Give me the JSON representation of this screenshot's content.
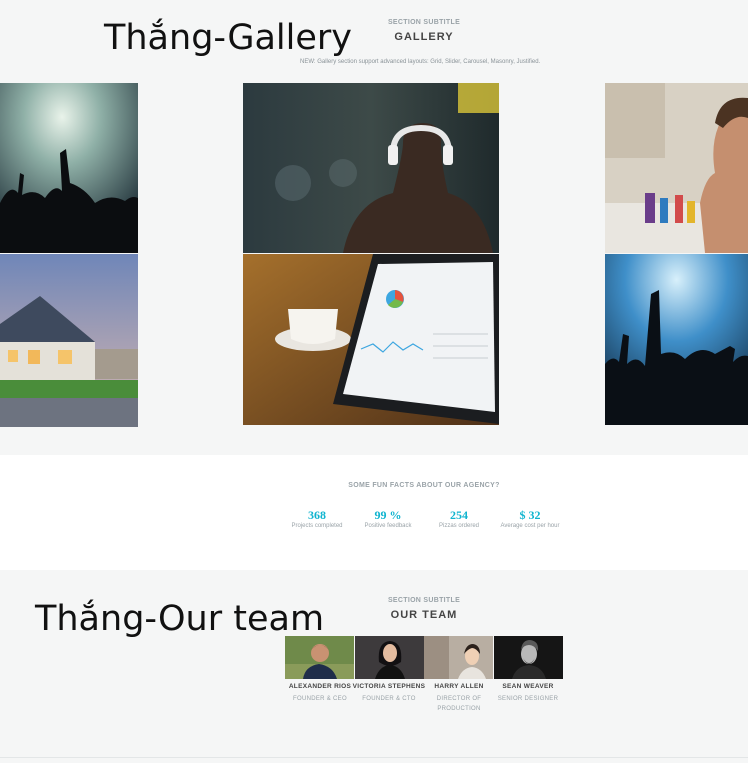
{
  "gallery": {
    "overlay_title": "Thắng-Gallery",
    "subtitle": "SECTION SUBTITLE",
    "title": "GALLERY",
    "note": "NEW: Gallery section support advanced layouts: Grid, Slider, Carousel, Masonry, Justified.",
    "tiles": [
      {
        "name": "concert-crowd-photo"
      },
      {
        "name": "headphones-man-photo"
      },
      {
        "name": "man-at-desk-photo"
      },
      {
        "name": "house-evening-photo"
      },
      {
        "name": "tablet-analytics-photo"
      },
      {
        "name": "concert-hands-photo"
      }
    ]
  },
  "facts": {
    "heading": "SOME FUN FACTS ABOUT OUR AGENCY?",
    "items": [
      {
        "value": "368",
        "label": "Projects completed"
      },
      {
        "value": "99 %",
        "label": "Positive feedback"
      },
      {
        "value": "254",
        "label": "Pizzas ordered"
      },
      {
        "value": "$ 32",
        "label": "Average cost per hour"
      }
    ],
    "accent": "#10b4cf"
  },
  "team": {
    "overlay_title": "Thắng-Our team",
    "subtitle": "SECTION SUBTITLE",
    "title": "OUR TEAM",
    "members": [
      {
        "name": "ALEXANDER RIOS",
        "role": "FOUNDER & CEO"
      },
      {
        "name": "VICTORIA STEPHENS",
        "role": "FOUNDER & CTO"
      },
      {
        "name": "HARRY ALLEN",
        "role": "DIRECTOR OF PRODUCTION"
      },
      {
        "name": "SEAN WEAVER",
        "role": "SENIOR DESIGNER"
      }
    ]
  }
}
